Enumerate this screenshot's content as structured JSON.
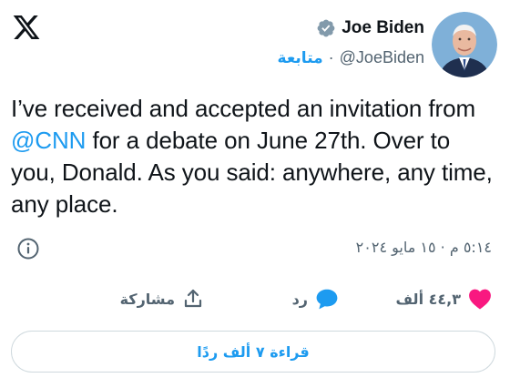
{
  "author": {
    "display_name": "Joe Biden",
    "handle": "@JoeBiden",
    "follow_label": "متابعة",
    "separator": "·"
  },
  "tweet": {
    "text_before": "I’ve received and accepted an invitation from ",
    "mention": "@CNN",
    "text_after": " for a debate on June 27th. Over to you, Donald. As you said: anywhere, any time, any place.",
    "timestamp": "٥:١٤ م · ١٥ مايو ٢٠٢٤"
  },
  "actions": {
    "likes_count": "٤٤,٣ ألف",
    "reply_label": "رد",
    "share_label": "مشاركة",
    "read_replies_label": "قراءة ٧ ألف ردًا"
  },
  "icons": {
    "logo": "x-logo-icon",
    "verified": "verified-badge-icon",
    "info": "info-icon",
    "like": "heart-icon",
    "reply": "reply-bubble-icon",
    "share": "share-icon"
  },
  "colors": {
    "accent": "#1d9bf0",
    "like": "#f91880",
    "secondary_text": "#536471",
    "verified_badge": "#829aab"
  }
}
